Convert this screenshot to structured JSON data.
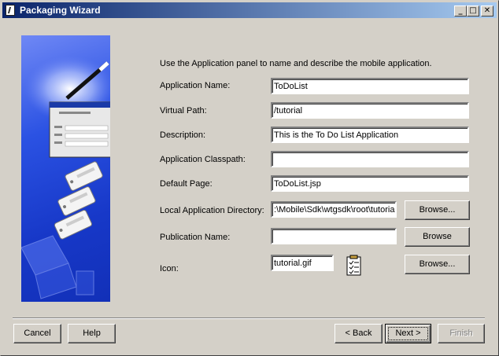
{
  "window": {
    "title": "Packaging Wizard"
  },
  "intro": "Use the Application panel to name and describe the mobile application.",
  "fields": {
    "app_name": {
      "label": "Application Name:",
      "value": "ToDoList"
    },
    "virtual_path": {
      "label": "Virtual Path:",
      "value": "/tutorial"
    },
    "description": {
      "label": "Description:",
      "value": "This is the To Do List Application"
    },
    "classpath": {
      "label": "Application Classpath:",
      "value": ""
    },
    "default_page": {
      "label": "Default Page:",
      "value": "ToDoList.jsp"
    },
    "local_dir": {
      "label": "Local Application Directory:",
      "value": ":\\Mobile\\Sdk\\wtgsdk\\root\\tutorial"
    },
    "publication": {
      "label": "Publication Name:",
      "value": ""
    },
    "icon": {
      "label": "Icon:",
      "value": "tutorial.gif"
    }
  },
  "buttons": {
    "browse_local": "Browse...",
    "browse_pub": "Browse",
    "browse_icon": "Browse...",
    "cancel": "Cancel",
    "help": "Help",
    "back": "< Back",
    "next": "Next >",
    "finish": "Finish"
  },
  "icons": {
    "title": "wizard-app-icon",
    "illustration": "wizard-illustration",
    "icon_preview": "checklist-icon"
  },
  "colors": {
    "titlebar_start": "#0a246a",
    "titlebar_end": "#a6caf0",
    "art_blue": "#1738c8"
  }
}
